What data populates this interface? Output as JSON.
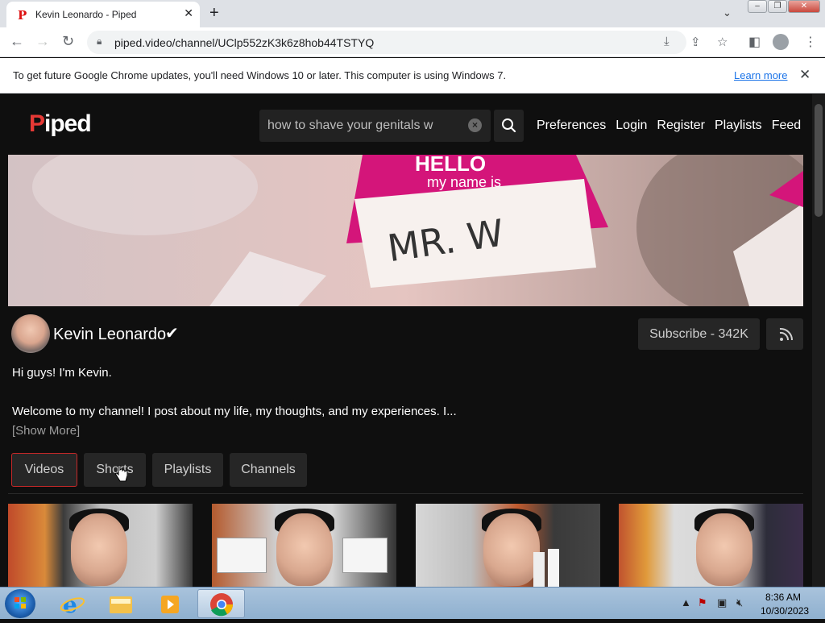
{
  "browser": {
    "tab": {
      "title": "Kevin Leonardo - Piped",
      "favicon": "P"
    },
    "address": "piped.video/channel/UClp552zK3k6z8hob44TSTYQ",
    "infobar": {
      "message": "To get future Google Chrome updates, you'll need Windows 10 or later. This computer is using Windows 7.",
      "link": "Learn more"
    }
  },
  "piped": {
    "logo": {
      "initial": "P",
      "rest": "iped"
    },
    "search": {
      "value": "how to shave your genitals w"
    },
    "nav": [
      "Preferences",
      "Login",
      "Register",
      "Playlists",
      "Feed"
    ],
    "banner": {
      "nametag_header": "HELLO",
      "nametag_sub": "my name is",
      "nametag_name": "MR. W"
    },
    "channel": {
      "name": "Kevin Leonardo",
      "verified_mark": "✔",
      "subscribe_label": "Subscribe - 342K",
      "description_line1": "Hi guys! I'm Kevin.",
      "description_line2": "Welcome to my channel! I post about my life, my thoughts, and my experiences. I...",
      "show_more": "[Show More]"
    },
    "tabs": [
      "Videos",
      "Shorts",
      "Playlists",
      "Channels"
    ],
    "active_tab": "Videos"
  },
  "taskbar": {
    "time": "8:36 AM",
    "date": "10/30/2023"
  },
  "colors": {
    "accent": "#c62828",
    "logo_red": "#e53935",
    "page_bg": "#0f0f0f",
    "button_bg": "#262626"
  }
}
